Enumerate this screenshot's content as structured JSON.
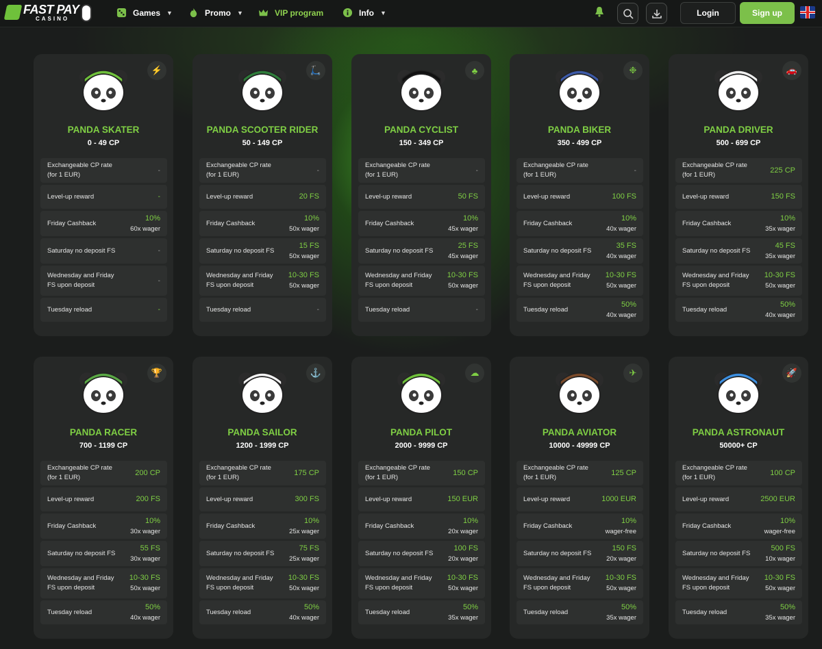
{
  "header": {
    "logo_text": "FAST PAY",
    "logo_sub": "CASINO",
    "nav": [
      {
        "label": "Games",
        "icon": "dice-icon"
      },
      {
        "label": "Promo",
        "icon": "fire-icon"
      },
      {
        "label": "VIP program",
        "icon": "crown-icon"
      },
      {
        "label": "Info",
        "icon": "info-icon"
      }
    ],
    "login_label": "Login",
    "signup_label": "Sign up",
    "accent": "#7cc04a"
  },
  "row_labels": {
    "rate": "Exchangeable CP rate (for 1 EUR)",
    "levelup": "Level-up reward",
    "cashback": "Friday Cashback",
    "saturday": "Saturday no deposit FS",
    "wednesday": "Wednesday and Friday FS upon deposit",
    "tuesday": "Tuesday reload"
  },
  "levels": [
    {
      "name": "PANDA SKATER",
      "cp": "0 - 49 CP",
      "icon": "lightning-icon",
      "rate": "-",
      "levelup": "-",
      "cashback": "10%",
      "cashback_wager": "60x wager",
      "saturday": "-",
      "saturday_wager": "",
      "wednesday": "-",
      "wednesday_wager": "",
      "tuesday": "-",
      "tuesday_wager": ""
    },
    {
      "name": "PANDA SCOOTER RIDER",
      "cp": "50 - 149 CP",
      "icon": "scooter-icon",
      "rate": "-",
      "levelup": "20 FS",
      "cashback": "10%",
      "cashback_wager": "50x wager",
      "saturday": "15 FS",
      "saturday_wager": "50x wager",
      "wednesday": "10-30 FS",
      "wednesday_wager": "50x wager",
      "tuesday": "-",
      "tuesday_wager": ""
    },
    {
      "name": "PANDA CYCLIST",
      "cp": "150 - 349 CP",
      "icon": "clover-icon",
      "rate": "-",
      "levelup": "50 FS",
      "cashback": "10%",
      "cashback_wager": "45x wager",
      "saturday": "25 FS",
      "saturday_wager": "45x wager",
      "wednesday": "10-30 FS",
      "wednesday_wager": "50x wager",
      "tuesday": "-",
      "tuesday_wager": ""
    },
    {
      "name": "PANDA BIKER",
      "cp": "350 - 499 CP",
      "icon": "wheel-icon",
      "rate": "-",
      "levelup": "100 FS",
      "cashback": "10%",
      "cashback_wager": "40x wager",
      "saturday": "35 FS",
      "saturday_wager": "40x wager",
      "wednesday": "10-30 FS",
      "wednesday_wager": "50x wager",
      "tuesday": "50%",
      "tuesday_wager": "40x wager"
    },
    {
      "name": "PANDA DRIVER",
      "cp": "500 - 699 CP",
      "icon": "car-icon",
      "rate": "225 CP",
      "levelup": "150 FS",
      "cashback": "10%",
      "cashback_wager": "35x wager",
      "saturday": "45 FS",
      "saturday_wager": "35x wager",
      "wednesday": "10-30 FS",
      "wednesday_wager": "50x wager",
      "tuesday": "50%",
      "tuesday_wager": "40x wager"
    },
    {
      "name": "PANDA RACER",
      "cp": "700 - 1199 CP",
      "icon": "trophy-icon",
      "rate": "200 CP",
      "levelup": "200 FS",
      "cashback": "10%",
      "cashback_wager": "30x wager",
      "saturday": "55 FS",
      "saturday_wager": "30x wager",
      "wednesday": "10-30 FS",
      "wednesday_wager": "50x wager",
      "tuesday": "50%",
      "tuesday_wager": "40x wager"
    },
    {
      "name": "PANDA SAILOR",
      "cp": "1200 - 1999 CP",
      "icon": "anchor-icon",
      "rate": "175 CP",
      "levelup": "300 FS",
      "cashback": "10%",
      "cashback_wager": "25x wager",
      "saturday": "75 FS",
      "saturday_wager": "25x wager",
      "wednesday": "10-30 FS",
      "wednesday_wager": "50x wager",
      "tuesday": "50%",
      "tuesday_wager": "40x wager"
    },
    {
      "name": "PANDA PILOT",
      "cp": "2000 - 9999 CP",
      "icon": "cloud-icon",
      "rate": "150 CP",
      "levelup": "150 EUR",
      "cashback": "10%",
      "cashback_wager": "20x wager",
      "saturday": "100 FS",
      "saturday_wager": "20x wager",
      "wednesday": "10-30 FS",
      "wednesday_wager": "50x wager",
      "tuesday": "50%",
      "tuesday_wager": "35x wager"
    },
    {
      "name": "PANDA AVIATOR",
      "cp": "10000 - 49999 CP",
      "icon": "plane-icon",
      "rate": "125 CP",
      "levelup": "1000 EUR",
      "cashback": "10%",
      "cashback_wager": "wager-free",
      "saturday": "150 FS",
      "saturday_wager": "20x wager",
      "wednesday": "10-30 FS",
      "wednesday_wager": "50x wager",
      "tuesday": "50%",
      "tuesday_wager": "35x wager"
    },
    {
      "name": "PANDA ASTRONAUT",
      "cp": "50000+ CP",
      "icon": "rocket-icon",
      "rate": "100 CP",
      "levelup": "2500 EUR",
      "cashback": "10%",
      "cashback_wager": "wager-free",
      "saturday": "500 FS",
      "saturday_wager": "10x wager",
      "wednesday": "10-30 FS",
      "wednesday_wager": "50x wager",
      "tuesday": "50%",
      "tuesday_wager": "35x wager"
    }
  ]
}
